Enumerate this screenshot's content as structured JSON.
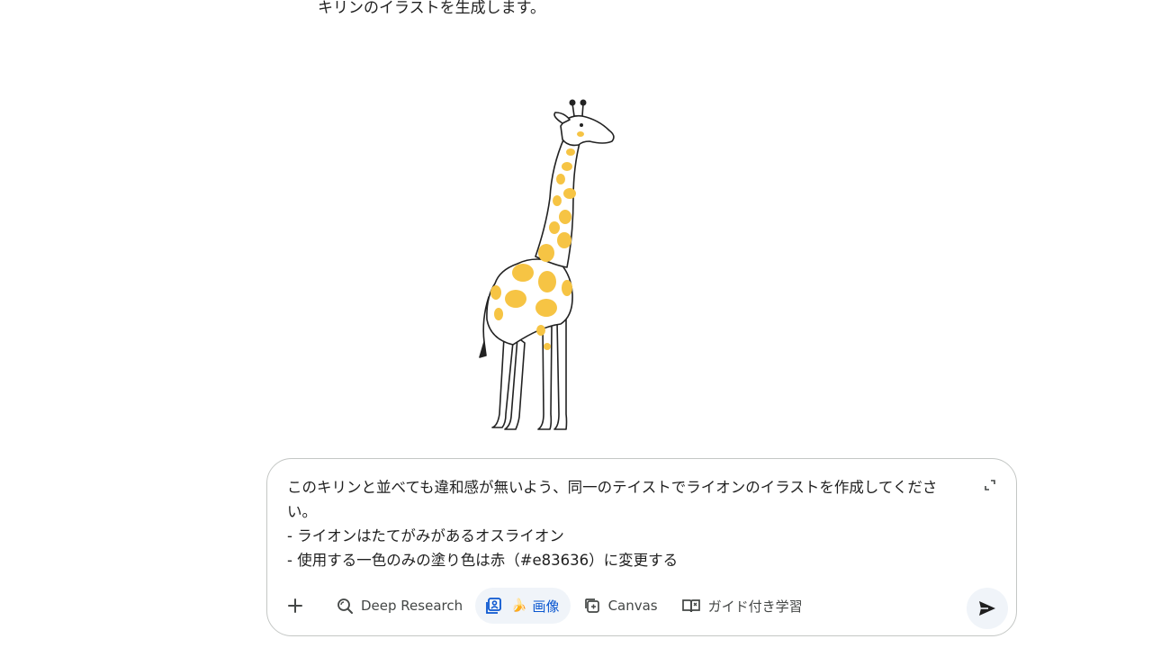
{
  "response": {
    "text": "キリンのイラストを生成します。"
  },
  "image": {
    "subject": "giraffe-illustration",
    "spot_color": "#f6c444",
    "outline_color": "#222222"
  },
  "prompt": {
    "lines": [
      "このキリンと並べても違和感が無いよう、同一のテイストでライオンのイラストを作成してくださ",
      "い。",
      "- ライオンはたてがみがあるオスライオン",
      "- 使用する一色のみの塗り色は赤（#e83636）に変更する"
    ]
  },
  "toolbar": {
    "add_icon": "plus-icon",
    "tools": [
      {
        "label": "Deep Research",
        "icon": "deep-research-icon",
        "active": false
      },
      {
        "label": "画像",
        "emoji": "🍌",
        "icon": "image-tool-icon",
        "active": true
      },
      {
        "label": "Canvas",
        "icon": "canvas-icon",
        "active": false
      },
      {
        "label": "ガイド付き学習",
        "icon": "guided-learning-icon",
        "active": false
      }
    ],
    "send_icon": "send-icon"
  },
  "colors": {
    "active_tool_bg": "#f0f4f9",
    "active_tool_text": "#0b57d0",
    "border": "#c4c7c5"
  }
}
